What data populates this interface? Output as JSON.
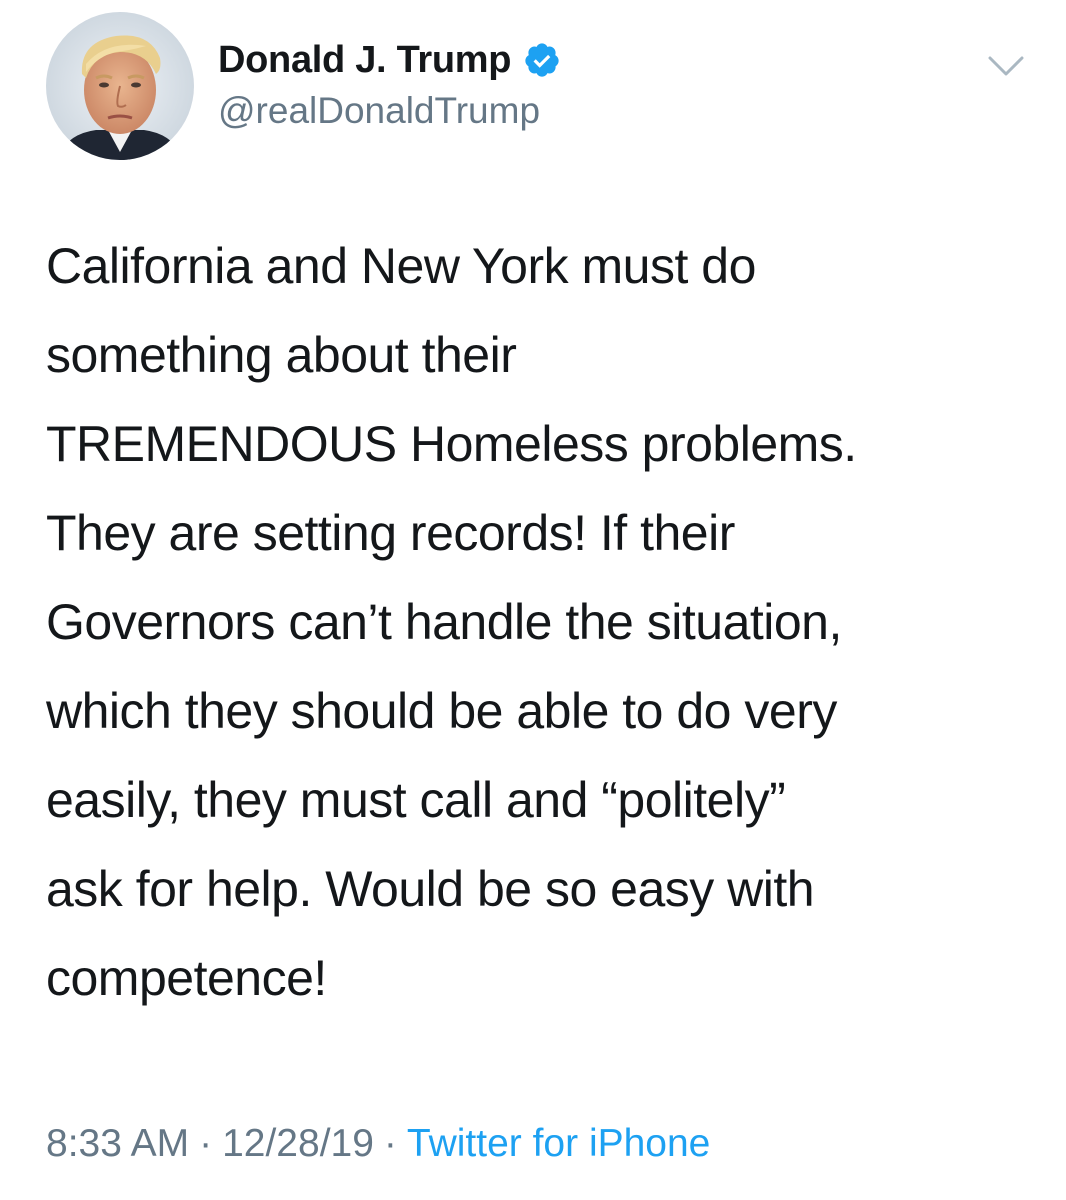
{
  "author": {
    "display_name": "Donald J. Trump",
    "handle": "@realDonaldTrump",
    "verified": true
  },
  "tweet": {
    "text_lines": [
      "California and New York must do",
      "something about their",
      "TREMENDOUS Homeless problems.",
      "They are setting records! If their",
      "Governors can’t handle the situation,",
      "which they should be able to do very",
      "easily, they must call and “politely”",
      "ask for help. Would be so easy with",
      "competence!"
    ]
  },
  "meta": {
    "time": "8:33 AM",
    "separator": "·",
    "date": "12/28/19",
    "source": "Twitter for iPhone"
  },
  "colors": {
    "text": "#14171a",
    "secondary": "#657786",
    "accent": "#1da1f2"
  },
  "icons": {
    "verified": "verified-badge-icon",
    "menu": "chevron-down-icon"
  }
}
